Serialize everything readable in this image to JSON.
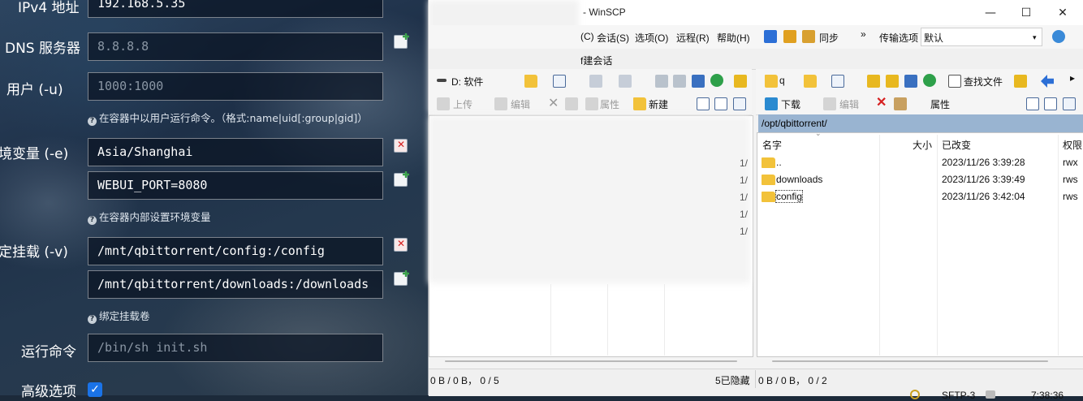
{
  "form": {
    "ipv4_label": "IPv4 地址",
    "ipv4_value": "192.168.5.35",
    "dns_label": "DNS 服务器",
    "dns_placeholder": "8.8.8.8",
    "user_label": "用户 (-u)",
    "user_placeholder": "1000:1000",
    "user_hint": "在容器中以用户运行命令。（格式:name|uid[:group|gid]）",
    "env_label": "境变量 (-e)",
    "env_values": [
      "Asia/Shanghai",
      "WEBUI_PORT=8080"
    ],
    "env_hint": "在容器内部设置环境变量",
    "mount_label": "定挂载 (-v)",
    "mount_values": [
      "/mnt/qbittorrent/config:/config",
      "/mnt/qbittorrent/downloads:/downloads"
    ],
    "mount_hint": "绑定挂载卷",
    "cmd_label": "运行命令",
    "cmd_placeholder": "/bin/sh init.sh",
    "advanced_label": "高级选项",
    "advanced_checked": true,
    "hint_icon": "?"
  },
  "winscp": {
    "title": "- WinSCP",
    "window_buttons": [
      "—",
      "☐",
      "✕"
    ],
    "menu": [
      "(C)",
      "会话(S)",
      "选项(O)",
      "远程(R)",
      "帮助(H)",
      "同步",
      "»",
      "传输选项",
      "默认"
    ],
    "tab_fragment": "f建会话",
    "left_toolbar": {
      "drive": "D: 软件",
      "upload": "上传",
      "edit": "编辑",
      "properties": "属性",
      "new": "新建"
    },
    "right_toolbar": {
      "folder": "q",
      "find_files": "查找文件",
      "download": "下载",
      "edit": "编辑",
      "properties": "属性"
    },
    "right_path": "/opt/qbittorrent/",
    "columns": [
      "名字",
      "大小",
      "已改变",
      "权限"
    ],
    "files": [
      {
        "name": "..",
        "changed": "2023/11/26 3:39:28",
        "rights": "rwx"
      },
      {
        "name": "downloads",
        "changed": "2023/11/26 3:39:49",
        "rights": "rws"
      },
      {
        "name": "config",
        "changed": "2023/11/26 3:42:04",
        "rights": "rws"
      }
    ],
    "left_marks": [
      "1/",
      "1/",
      "1/",
      "1/",
      "1/"
    ],
    "left_status": "0 B / 0 B，  0 / 5",
    "left_hidden": "5已隐藏",
    "right_status": "0 B / 0 B，  0 / 2",
    "protocol": "SFTP-3",
    "time_fragment": "7:38:36"
  }
}
